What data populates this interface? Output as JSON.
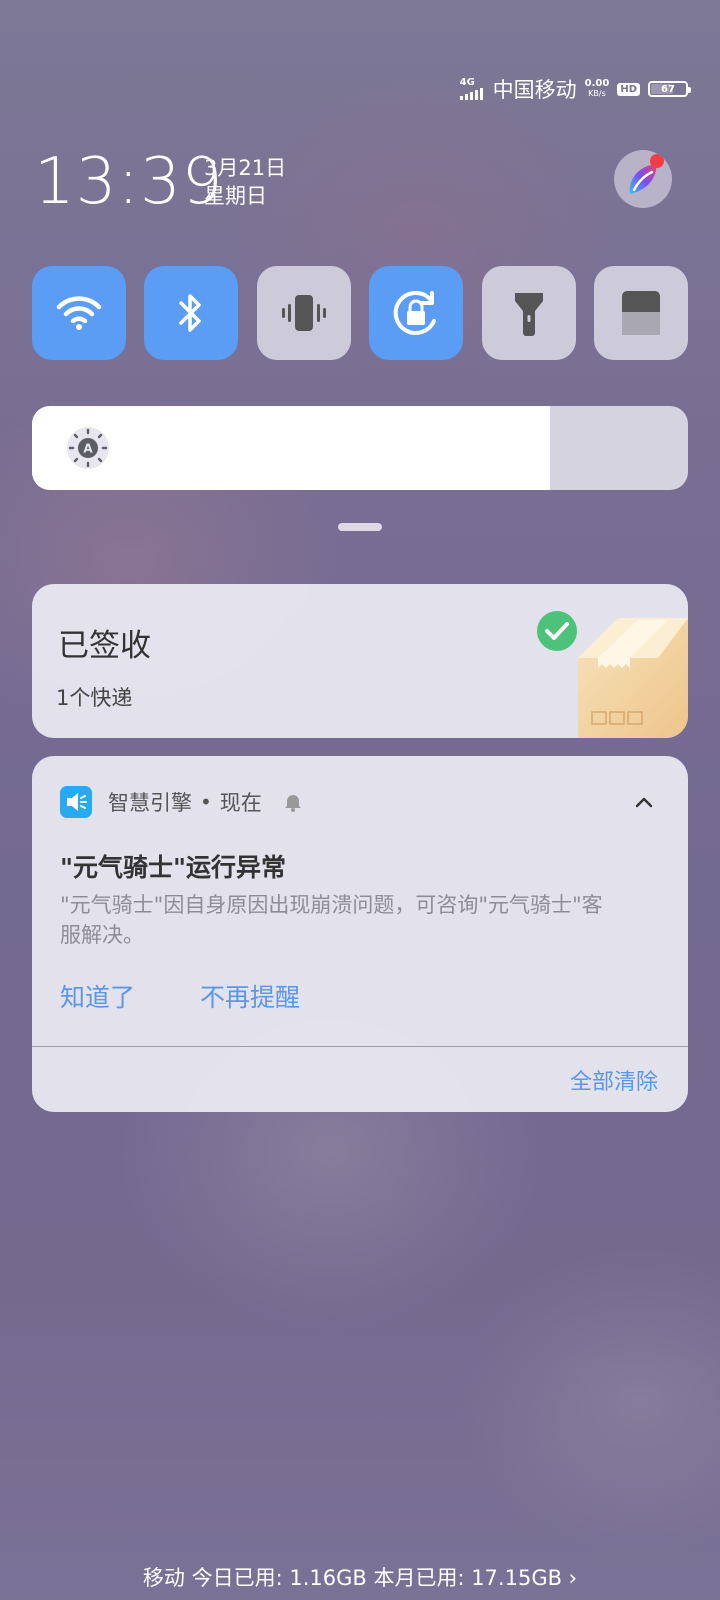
{
  "status_bar": {
    "network_type": "4G",
    "carrier": "中国移动",
    "speed_value": "0.00",
    "speed_unit": "KB/s",
    "hd_label": "HD",
    "battery_level": "67"
  },
  "clock": {
    "time": "13:39",
    "date": "3月21日",
    "weekday": "星期日"
  },
  "toggles": [
    {
      "icon": "wifi-icon",
      "on": true
    },
    {
      "icon": "bluetooth-icon",
      "on": true
    },
    {
      "icon": "vibrate-icon",
      "on": false
    },
    {
      "icon": "rotation-lock-icon",
      "on": true
    },
    {
      "icon": "flashlight-icon",
      "on": false
    },
    {
      "icon": "eye-comfort-icon",
      "on": false
    }
  ],
  "brightness": {
    "icon": "auto-brightness-icon",
    "icon_letter": "A",
    "level": 0.79
  },
  "express_card": {
    "title": "已签收",
    "subtitle": "1个快递"
  },
  "notification": {
    "app_name": "智慧引擎",
    "separator": "•",
    "time": "现在",
    "title": "\"元气骑士\"运行异常",
    "body": "\"元气骑士\"因自身原因出现崩溃问题，可咨询\"元气骑士\"客服解决。",
    "action_primary": "知道了",
    "action_secondary": "不再提醒",
    "clear_all": "全部清除"
  },
  "colors": {
    "accent": "#5b9cf5",
    "link": "#5b97e5"
  },
  "data_usage": "移动 今日已用: 1.16GB 本月已用: 17.15GB ›"
}
